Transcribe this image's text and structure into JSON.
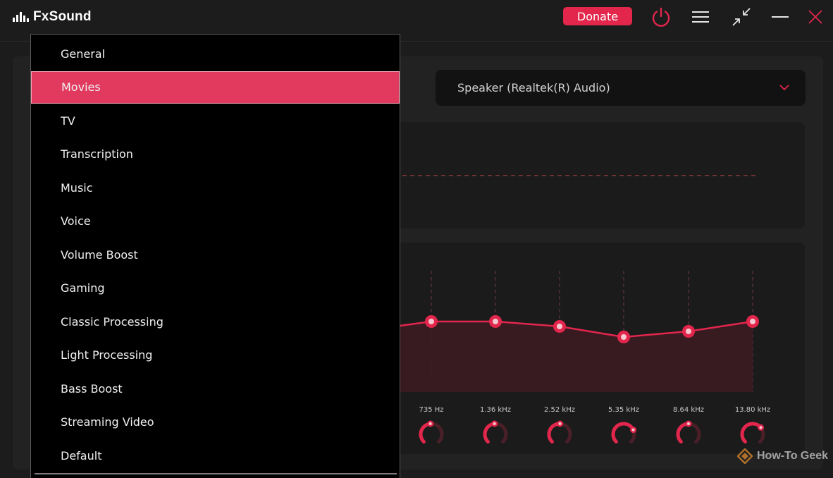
{
  "app": {
    "title": "FxSound",
    "donate_label": "Donate",
    "accent": "#e2264c"
  },
  "titlebar_icons": [
    "power-icon",
    "menu-icon",
    "compact-view-icon",
    "minimize-icon",
    "close-icon"
  ],
  "device": {
    "selected": "Speaker (Realtek(R) Audio)"
  },
  "preset_menu": {
    "selected_index": 1,
    "items": [
      "General",
      "Movies",
      "TV",
      "Transcription",
      "Music",
      "Voice",
      "Volume Boost",
      "Gaming",
      "Classic Processing",
      "Light Processing",
      "Bass Boost",
      "Streaming Video",
      "Default"
    ]
  },
  "equalizer": {
    "bands": [
      {
        "label": "735 Hz"
      },
      {
        "label": "1.36 kHz"
      },
      {
        "label": "2.52 kHz"
      },
      {
        "label": "5.35 kHz"
      },
      {
        "label": "8.64 kHz"
      },
      {
        "label": "13.80 kHz"
      }
    ]
  },
  "watermark": {
    "text": "How-To Geek"
  }
}
